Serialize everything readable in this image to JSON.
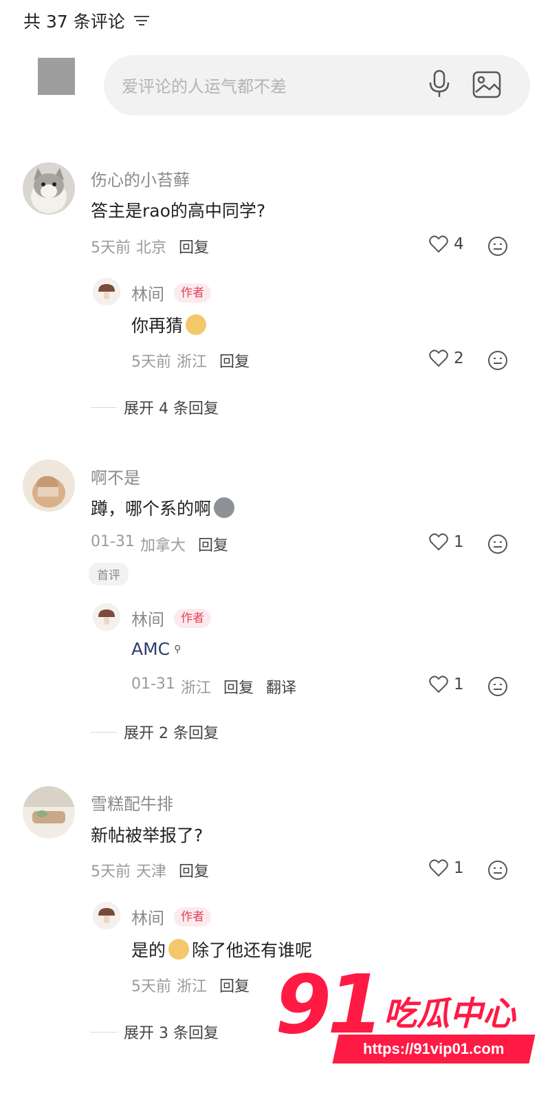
{
  "header": {
    "count_label": "共 37 条评论"
  },
  "composer": {
    "placeholder": "爱评论的人运气都不差"
  },
  "comments": [
    {
      "name": "伤心的小苔藓",
      "text": "答主是rao的高中同学?",
      "time": "5天前",
      "location": "北京",
      "reply_label": "回复",
      "likes": "4",
      "reply": {
        "name": "林间",
        "tag": "作者",
        "text": "你再猜",
        "time": "5天前",
        "location": "浙江",
        "reply_label": "回复",
        "likes": "2"
      },
      "expand": "展开 4 条回复"
    },
    {
      "name": "啊不是",
      "text": "蹲，哪个系的啊",
      "time": "01-31",
      "location": "加拿大",
      "reply_label": "回复",
      "likes": "1",
      "badge": "首评",
      "reply": {
        "name": "林间",
        "tag": "作者",
        "text": "AMC",
        "time": "01-31",
        "location": "浙江",
        "reply_label": "回复",
        "translate_label": "翻译",
        "likes": "1"
      },
      "expand": "展开 2 条回复"
    },
    {
      "name": "雪糕配牛排",
      "text": "新帖被举报了?",
      "time": "5天前",
      "location": "天津",
      "reply_label": "回复",
      "likes": "1",
      "reply": {
        "name": "林间",
        "tag": "作者",
        "text_before": "是的",
        "text_after": "除了他还有谁呢",
        "time": "5天前",
        "location": "浙江",
        "reply_label": "回复"
      },
      "expand": "展开 3 条回复"
    }
  ],
  "watermark": {
    "number": "91",
    "brand": "吃瓜中心",
    "url": "https://91vip01.com"
  },
  "colors": {
    "accent": "#ff1a44",
    "author_tag": "#e0435a",
    "muted": "#9a9a9a"
  }
}
